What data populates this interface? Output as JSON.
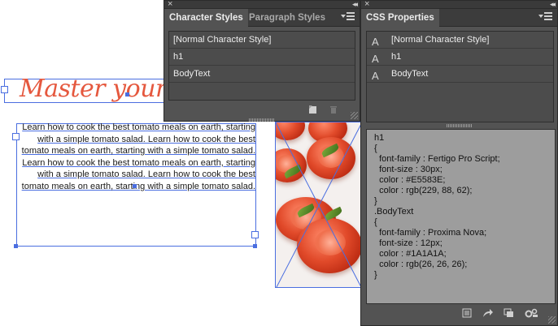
{
  "canvas": {
    "heading_text": "Master your to",
    "body_text": "Learn how to cook the best tomato meals on earth, starting with a simple tomato salad. Learn how to cook the best tomato meals on earth, starting with a simple tomato salad. Learn how to cook the best tomato meals on earth, starting with a simple tomato salad. Learn how to cook the best tomato meals on earth, starting with a simple tomato salad."
  },
  "char_panel": {
    "tabs": [
      "Character Styles",
      "Paragraph Styles"
    ],
    "active_tab": "Character Styles",
    "items": [
      "[Normal Character Style]",
      "h1",
      "BodyText"
    ],
    "icons": [
      "close-icon",
      "collapse-icon",
      "panel-menu-icon",
      "new-style-icon",
      "delete-style-icon",
      "resize-grip-icon"
    ]
  },
  "css_panel": {
    "title": "CSS Properties",
    "items": [
      "[Normal Character Style]",
      "h1",
      "BodyText"
    ],
    "code_lines": [
      "h1",
      "{",
      "  font-family : Fertigo Pro Script;",
      "  font-size : 30px;",
      "  color : #E5583E;",
      "  color : rgb(229, 88, 62);",
      "}",
      ".BodyText",
      "{",
      "  font-family : Proxima Nova;",
      "  font-size : 12px;",
      "  color : #1A1A1A;",
      "  color : rgb(26, 26, 26);",
      "}"
    ],
    "footer_icons": [
      "generate-css-icon",
      "share-icon",
      "copy-icon",
      "settings-icon"
    ]
  },
  "colors": {
    "heading": "#E5583E",
    "body_text": "#1A1A1A",
    "selection": "#4A6EE0",
    "panel_bg": "#535353"
  }
}
